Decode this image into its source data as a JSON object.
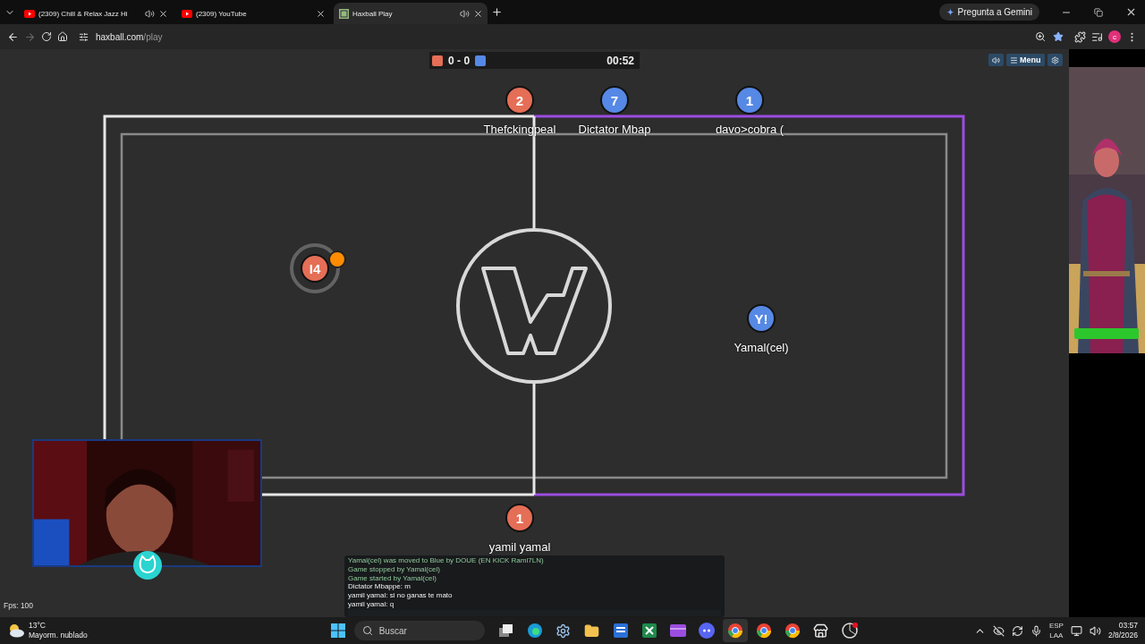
{
  "browser": {
    "tabs": [
      {
        "title": "(2309) Chill & Relax Jazz Hi",
        "kind": "video",
        "audio": true,
        "selected": false
      },
      {
        "title": "(2309) YouTube",
        "kind": "video",
        "audio": false,
        "selected": false
      },
      {
        "title": "Haxball Play",
        "kind": "game",
        "audio": true,
        "selected": true
      }
    ],
    "assistant_button": "Pregunta a Gemini",
    "address": {
      "host": "haxball.com",
      "path": "/play"
    },
    "profile": "c"
  },
  "game": {
    "score": {
      "red": "0",
      "separator": "-",
      "blue": "0"
    },
    "time": "00:52",
    "menu_label": "Menu",
    "players": [
      {
        "number": "2",
        "name": "Thefckingpeal",
        "color": "#e56e56",
        "highlighted": false
      },
      {
        "number": "7",
        "name": "Dictator Mbap",
        "color": "#5689e5",
        "highlighted": false
      },
      {
        "number": "1",
        "name": "davo>cobra (",
        "color": "#5689e5",
        "highlighted": false
      },
      {
        "number": "I4",
        "color": "#e56e56",
        "highlighted": true
      },
      {
        "number": "Y!",
        "name": "Yamal(cel)",
        "color": "#5689e5",
        "highlighted": false
      },
      {
        "number": "1",
        "name": "yamil yamal",
        "color": "#e56e56",
        "highlighted": false
      }
    ],
    "chat": [
      {
        "text": "Yamal(cel) was moved to Blue by DOUE (EN KICK Rami7LN)",
        "kind": "notice"
      },
      {
        "text": "Game stopped by Yamal(cel)",
        "kind": "notice"
      },
      {
        "text": "Game started by Yamal(cel)",
        "kind": "notice"
      },
      {
        "text": "Dictator Mbappe: m",
        "kind": "message"
      },
      {
        "text": "yamil yamal: si no ganas te mato",
        "kind": "message"
      },
      {
        "text": "yamil yamal: q",
        "kind": "message"
      }
    ],
    "fps": "Fps: 100"
  },
  "taskbar": {
    "weather": {
      "temperature": "13°C",
      "description": "Mayorm. nublado"
    },
    "search": {
      "placeholder": "Buscar"
    },
    "language": [
      "ESP",
      "LAA"
    ],
    "time": "03:57",
    "date": "2/8/2026"
  }
}
